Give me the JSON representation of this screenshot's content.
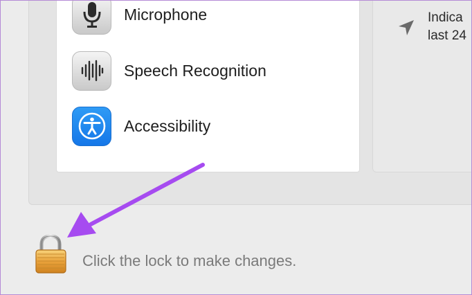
{
  "privacy_list": {
    "items": [
      {
        "label": "Microphone",
        "icon": "microphone-icon"
      },
      {
        "label": "Speech Recognition",
        "icon": "waveform-icon"
      },
      {
        "label": "Accessibility",
        "icon": "accessibility-icon"
      }
    ]
  },
  "info_panel": {
    "line1": "Indica",
    "line2": "last 24",
    "icon": "location-arrow-icon"
  },
  "lock": {
    "label": "Click the lock to make changes.",
    "icon": "lock-icon"
  },
  "annotation": {
    "icon": "purple-arrow-icon",
    "color": "#a64bf0"
  },
  "colors": {
    "accessibility_blue": "#1a84f0",
    "window_border": "#b58ad6"
  }
}
